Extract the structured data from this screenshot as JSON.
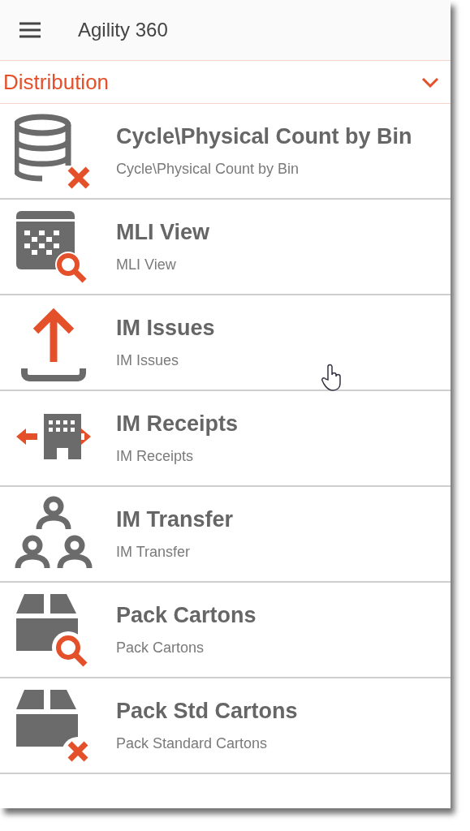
{
  "app_bar": {
    "title": "Agility 360"
  },
  "section": {
    "title": "Distribution",
    "expanded": true
  },
  "items": [
    {
      "kind": "database-x",
      "title": "Cycle\\Physical Count by Bin",
      "subtitle": "Cycle\\Physical Count by Bin"
    },
    {
      "kind": "calendar-search",
      "title": "MLI View",
      "subtitle": "MLI View"
    },
    {
      "kind": "upload",
      "title": "IM Issues",
      "subtitle": "IM Issues"
    },
    {
      "kind": "building-arrows",
      "title": "IM Receipts",
      "subtitle": "IM Receipts"
    },
    {
      "kind": "people",
      "title": "IM Transfer",
      "subtitle": "IM Transfer"
    },
    {
      "kind": "box-search",
      "title": "Pack Cartons",
      "subtitle": "Pack Cartons"
    },
    {
      "kind": "box-x",
      "title": "Pack Std Cartons",
      "subtitle": "Pack Standard Cartons"
    }
  ]
}
